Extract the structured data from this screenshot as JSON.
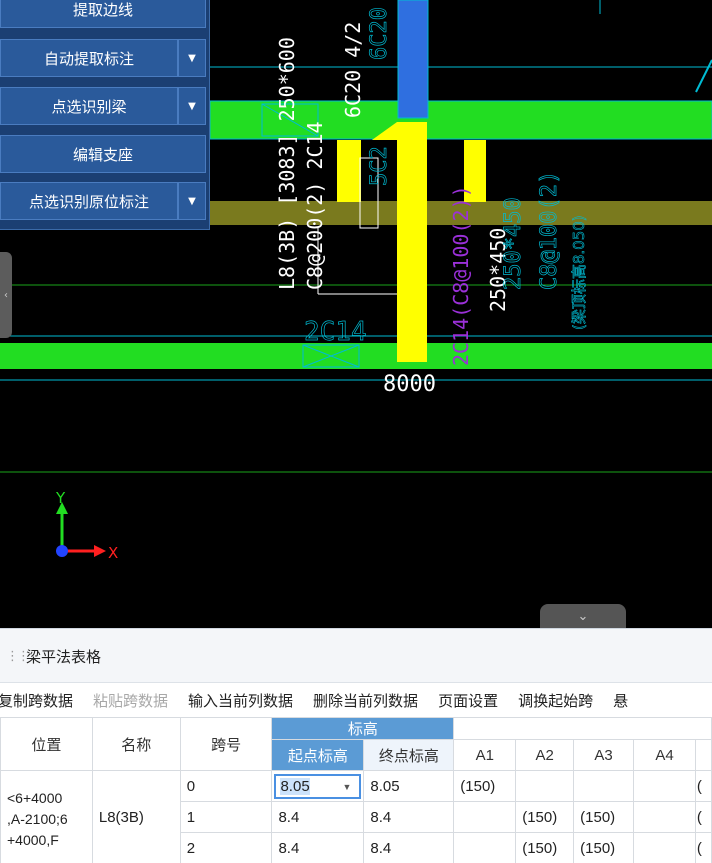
{
  "cmd_panel": {
    "items": [
      {
        "label": "提取边线",
        "has_dropdown": false
      },
      {
        "label": "自动提取标注",
        "has_dropdown": true
      },
      {
        "label": "点选识别梁",
        "has_dropdown": true
      },
      {
        "label": "编辑支座",
        "has_dropdown": false
      },
      {
        "label": "点选识别原位标注",
        "has_dropdown": true
      }
    ]
  },
  "cad": {
    "labels": {
      "beam_left": "L8(3B) [3083] 250*600",
      "beam_left_2": "C8@200(2) 2C14",
      "rebar_top": "6C20 4/2",
      "rebar_top_2": "6C20 4",
      "beam_right": "2C14(C8@100(2))",
      "beam_right_size": "250*450",
      "beam_right_faint": "250*450",
      "beam_right_faint_2": "C8@100(2)",
      "beam_right_faint_3": "(梁顶标高8.050)",
      "rebar_bottom": "2C14",
      "rebar_mid": "5C2",
      "dimension": "8000",
      "axis_x": "X",
      "axis_y": "Y"
    },
    "colors": {
      "green": "#22dd22",
      "yellow": "#ffff00",
      "olive": "#7a7a1e",
      "cyan": "#00bcd4",
      "blue": "#2f6fe0",
      "white": "#ffffff"
    }
  },
  "table_panel": {
    "title": "梁平法表格",
    "toolbar": [
      {
        "label": "复制跨数据",
        "disabled": false
      },
      {
        "label": "粘贴跨数据",
        "disabled": true
      },
      {
        "label": "输入当前列数据",
        "disabled": false
      },
      {
        "label": "删除当前列数据",
        "disabled": false
      },
      {
        "label": "页面设置",
        "disabled": false
      },
      {
        "label": "调换起始跨",
        "disabled": false
      },
      {
        "label": "悬",
        "disabled": false
      }
    ],
    "headers": {
      "position": "位置",
      "name": "名称",
      "span": "跨号",
      "elevation_group": "标高",
      "start_elev": "起点标高",
      "end_elev": "终点标高",
      "a1": "A1",
      "a2": "A2",
      "a3": "A3",
      "a4": "A4"
    },
    "position_text": "<6+4000\n,A-2100;6\n+4000,F",
    "name_text": "L8(3B)",
    "rows": [
      {
        "span": "0",
        "start": "8.05",
        "end": "8.05",
        "a1": "(150)",
        "a2": "",
        "a3": "",
        "a4": "",
        "extra": "("
      },
      {
        "span": "1",
        "start": "8.4",
        "end": "8.4",
        "a1": "",
        "a2": "(150)",
        "a3": "(150)",
        "a4": "",
        "extra": "("
      },
      {
        "span": "2",
        "start": "8.4",
        "end": "8.4",
        "a1": "",
        "a2": "(150)",
        "a3": "(150)",
        "a4": "",
        "extra": "("
      }
    ]
  }
}
